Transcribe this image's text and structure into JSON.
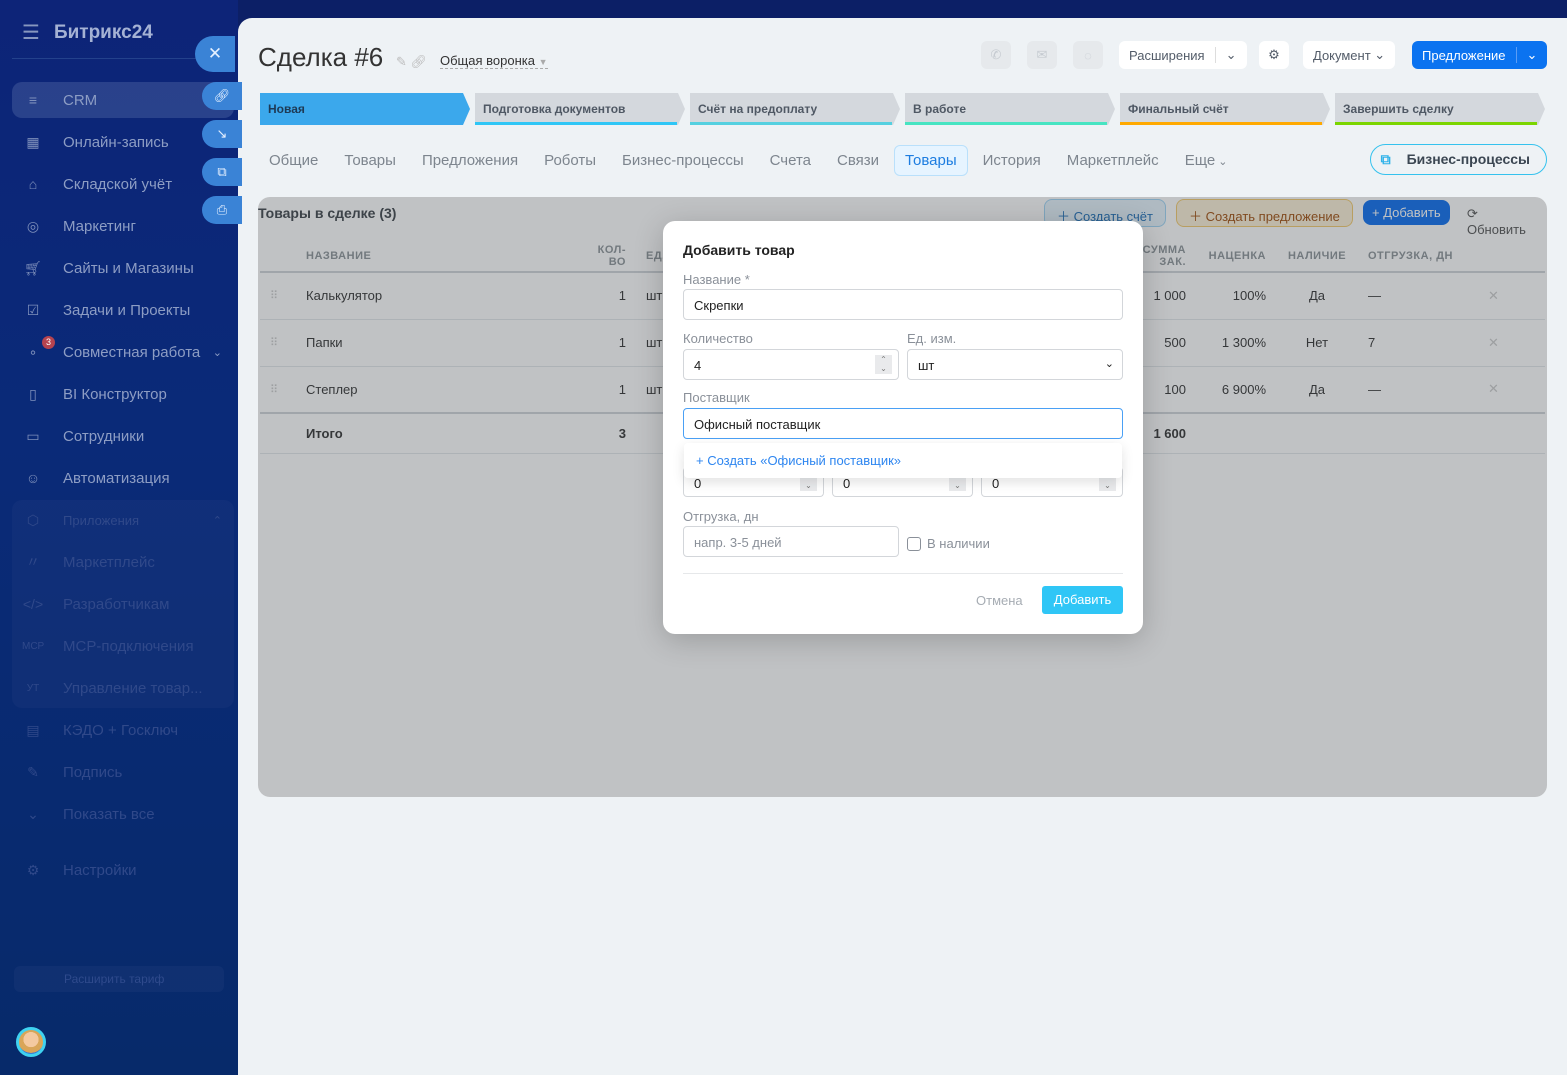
{
  "sidebar": {
    "logo": "Битрикс24",
    "items": [
      {
        "label": "CRM",
        "icon": "funnel-icon"
      },
      {
        "label": "Онлайн-запись",
        "icon": "calendar-icon"
      },
      {
        "label": "Складской учёт",
        "icon": "warehouse-icon"
      },
      {
        "label": "Маркетинг",
        "icon": "target-icon"
      },
      {
        "label": "Сайты и Магазины",
        "icon": "cart-icon"
      },
      {
        "label": "Задачи и Проекты",
        "icon": "checkbox-icon"
      },
      {
        "label": "Совместная работа",
        "icon": "collab-icon",
        "badge": "3"
      },
      {
        "label": "BI Конструктор",
        "icon": "bars-icon"
      },
      {
        "label": "Сотрудники",
        "icon": "id-card-icon"
      },
      {
        "label": "Автоматизация",
        "icon": "robot-icon"
      }
    ],
    "apps_label": "Приложения",
    "apps": [
      {
        "label": "Маркетплейс",
        "icon": "marketplace-icon"
      },
      {
        "label": "Разработчикам",
        "icon": "code-icon"
      },
      {
        "label": "MCP-подключения",
        "icon": "mcp-icon"
      },
      {
        "label": "Управление товар...",
        "icon": "ut-icon",
        "icon_text": "УТ"
      }
    ],
    "more": [
      {
        "label": "КЭДО + Госключ",
        "icon": "document-icon"
      },
      {
        "label": "Подпись",
        "icon": "signature-icon"
      },
      {
        "label": "Показать все",
        "icon": "chevron-down-icon"
      },
      {
        "label": "Настройки",
        "icon": "gear-icon"
      }
    ],
    "tariff": "Расширить тариф"
  },
  "header": {
    "title": "Сделка #6",
    "funnel": "Общая воронка",
    "extensions": "Расширения",
    "document": "Документ",
    "offer": "Предложение"
  },
  "stages": [
    {
      "label": "Новая",
      "color": "#3ba8ec"
    },
    {
      "label": "Подготовка документов",
      "color": "#2fc6f6"
    },
    {
      "label": "Счёт на предоплату",
      "color": "#55d0e0"
    },
    {
      "label": "В работе",
      "color": "#47e4c2"
    },
    {
      "label": "Финальный счёт",
      "color": "#ffa900"
    },
    {
      "label": "Завершить сделку",
      "color": "#7bd500"
    }
  ],
  "tabs": [
    "Общие",
    "Товары",
    "Предложения",
    "Роботы",
    "Бизнес-процессы",
    "Счета",
    "Связи",
    "Товары",
    "История",
    "Маркетплейс",
    "Еще"
  ],
  "bp_button": "Бизнес-процессы",
  "products": {
    "title": "Товары в сделке (3)",
    "create_invoice": "Создать счёт",
    "create_offer": "Создать предложение",
    "add": "Добавить",
    "refresh": "Обновить",
    "columns": [
      "НАЗВАНИЕ",
      "КОЛ-ВО",
      "ЕД.",
      "СУММА ЗАК.",
      "НАЦЕНКА",
      "НАЛИЧИЕ",
      "ОТГРУЗКА, ДН"
    ],
    "rows": [
      {
        "name": "Калькулятор",
        "qty": "1",
        "unit": "шт",
        "cost": "1 000",
        "markup": "100%",
        "stock": "Да",
        "ship": "—"
      },
      {
        "name": "Папки",
        "qty": "1",
        "unit": "шт",
        "cost": "500",
        "markup": "1 300%",
        "stock": "Нет",
        "ship": "7"
      },
      {
        "name": "Степлер",
        "qty": "1",
        "unit": "шт",
        "cost": "100",
        "markup": "6 900%",
        "stock": "Да",
        "ship": "—"
      }
    ],
    "total_label": "Итого",
    "total_qty": "3",
    "total_cost": "1 600"
  },
  "modal": {
    "title": "Добавить товар",
    "name_label": "Название *",
    "name_value": "Скрепки",
    "qty_label": "Количество",
    "qty_value": "4",
    "unit_label": "Ед. изм.",
    "unit_value": "шт",
    "supplier_label": "Поставщик",
    "supplier_value": "Офисный поставщик",
    "create_suggestion": "+ Создать «Офисный поставщик»",
    "num1": "0",
    "num2": "0",
    "num3": "0",
    "ship_label": "Отгрузка, дн",
    "ship_placeholder": "напр. 3-5 дней",
    "in_stock": "В наличии",
    "cancel": "Отмена",
    "add": "Добавить"
  }
}
